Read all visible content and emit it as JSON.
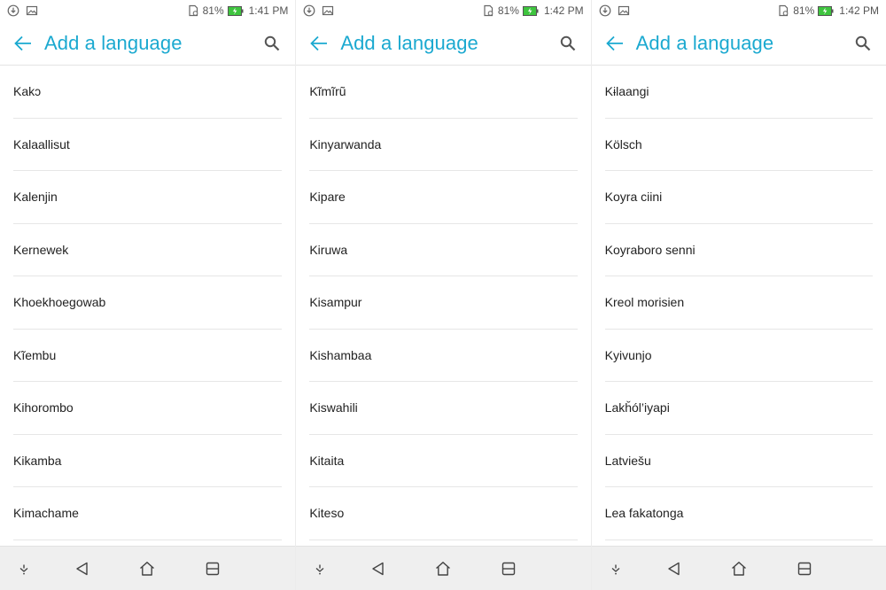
{
  "panels": [
    {
      "status": {
        "battery": "81%",
        "time": "1:41 PM"
      },
      "title": "Add a language",
      "languages": [
        "Kakɔ",
        "Kalaallisut",
        "Kalenjin",
        "Kernewek",
        "Khoekhoegowab",
        "Kĩembu",
        "Kihorombo",
        "Kikamba",
        "Kimachame"
      ]
    },
    {
      "status": {
        "battery": "81%",
        "time": "1:42 PM"
      },
      "title": "Add a language",
      "languages": [
        "Kĩmĩrũ",
        "Kinyarwanda",
        "Kipare",
        "Kiruwa",
        "Kisampur",
        "Kishambaa",
        "Kiswahili",
        "Kitaita",
        "Kiteso"
      ]
    },
    {
      "status": {
        "battery": "81%",
        "time": "1:42 PM"
      },
      "title": "Add a language",
      "languages": [
        "Kɨlaangi",
        "Kölsch",
        "Koyra ciini",
        "Koyraboro senni",
        "Kreol morisien",
        "Kyivunjo",
        "Lakȟól’iyapi",
        "Latviešu",
        "Lea fakatonga"
      ]
    }
  ],
  "colors": {
    "accent": "#1ba9d0",
    "battery": "#3ec43e",
    "divider": "#e6e6e6",
    "nav_bg": "#efefef"
  },
  "icons": {
    "status_left": [
      "download-notification-icon",
      "image-notification-icon"
    ],
    "status_right": [
      "sim-card-icon",
      "battery-charging-icon"
    ],
    "app_bar": [
      "back-arrow-icon",
      "search-icon"
    ],
    "nav_bar": [
      "hide-nav-icon",
      "back-triangle-icon",
      "home-icon",
      "recent-apps-icon"
    ]
  }
}
